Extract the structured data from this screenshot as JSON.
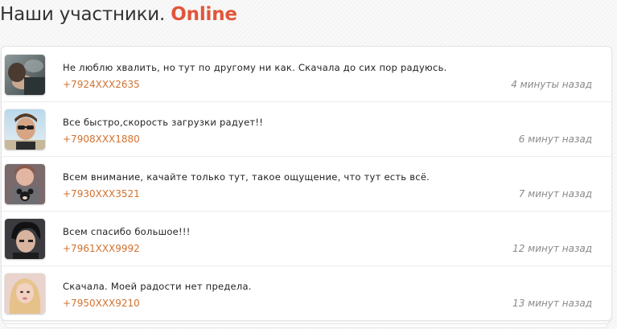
{
  "heading": {
    "prefix": "Наши участники.",
    "highlight": "Online"
  },
  "colors": {
    "accent": "#e2553a",
    "phone": "#d2712f",
    "time": "#8a8a8a"
  },
  "reviews": [
    {
      "avatar": "user-photo-dark-icon",
      "text": "Не люблю хвалить, но тут по другому ни как. Скачала до сих пор радуюсь.",
      "phone": "+7924XXX2635",
      "time": "4 минуты назад"
    },
    {
      "avatar": "user-photo-sunglasses-icon",
      "text": "Все быстро,скорость загрузки радует!!",
      "phone": "+7908XXX1880",
      "time": "6 минут назад"
    },
    {
      "avatar": "user-photo-mickey-shirt-icon",
      "text": "Всем внимание, качайте только тут, такое ощущение, что тут есть всё.",
      "phone": "+7930XXX3521",
      "time": "7 минут назад"
    },
    {
      "avatar": "user-photo-dark-hair-icon",
      "text": "Всем спасибо большое!!!",
      "phone": "+7961XXX9992",
      "time": "12 минут назад"
    },
    {
      "avatar": "user-photo-blonde-icon",
      "text": "Скачала. Моей радости нет предела.",
      "phone": "+7950XXX9210",
      "time": "13 минут назад"
    }
  ]
}
